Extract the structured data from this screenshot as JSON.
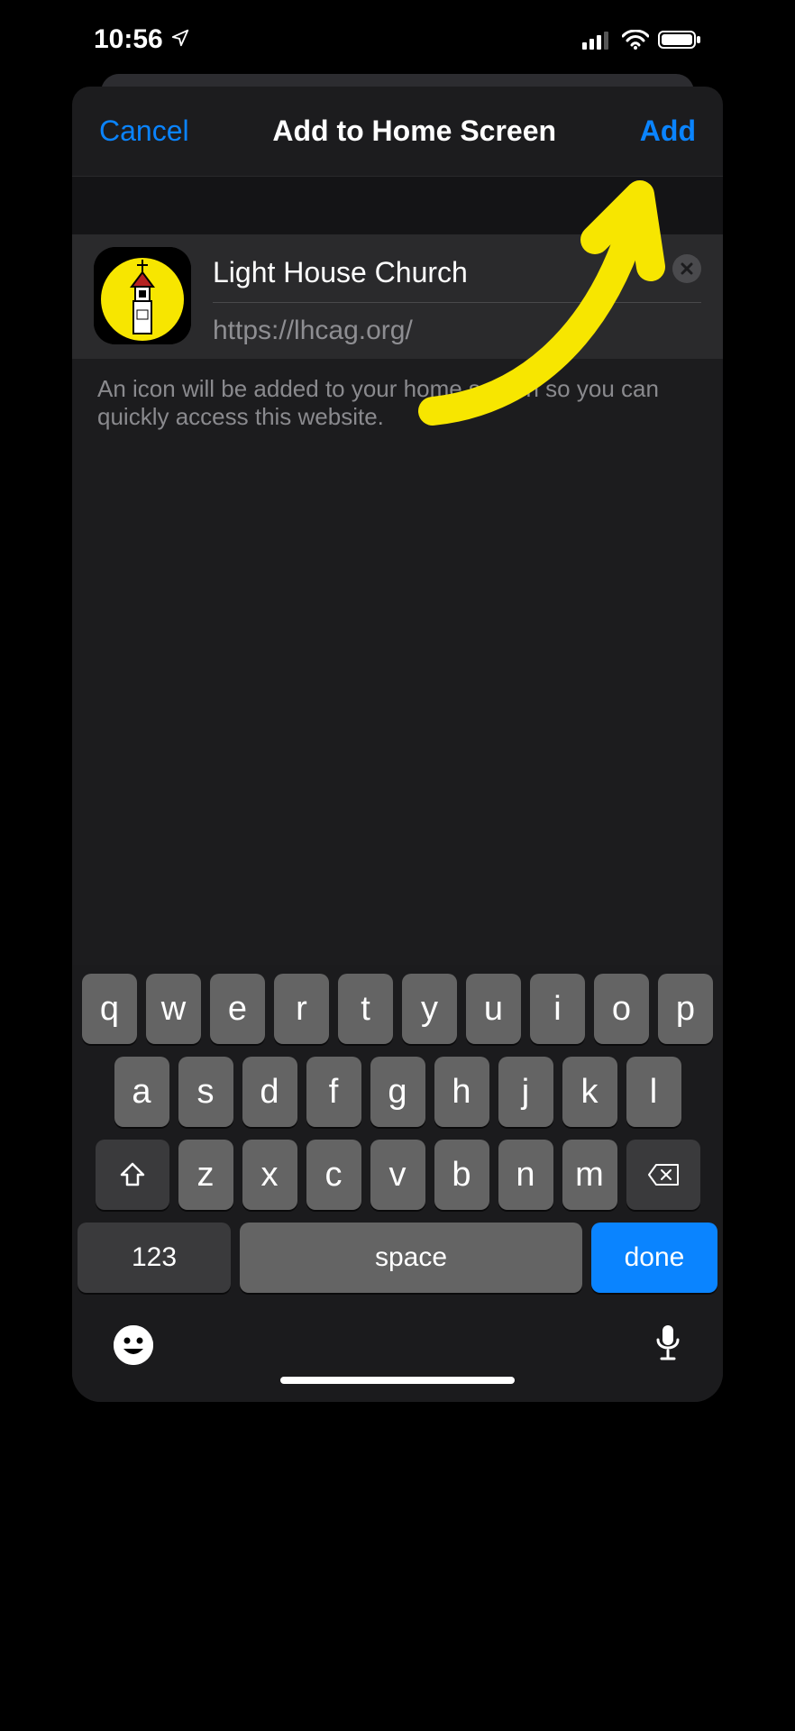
{
  "status": {
    "time": "10:56"
  },
  "sheet": {
    "cancel_label": "Cancel",
    "title": "Add to Home Screen",
    "add_label": "Add"
  },
  "form": {
    "title_value": "Light House Church",
    "url": "https://lhcag.org/"
  },
  "helper": "An icon will be added to your home screen so you can quickly access this website.",
  "keyboard": {
    "row1": [
      "q",
      "w",
      "e",
      "r",
      "t",
      "y",
      "u",
      "i",
      "o",
      "p"
    ],
    "row2": [
      "a",
      "s",
      "d",
      "f",
      "g",
      "h",
      "j",
      "k",
      "l"
    ],
    "row3": [
      "z",
      "x",
      "c",
      "v",
      "b",
      "n",
      "m"
    ],
    "numbers_label": "123",
    "space_label": "space",
    "done_label": "done"
  }
}
